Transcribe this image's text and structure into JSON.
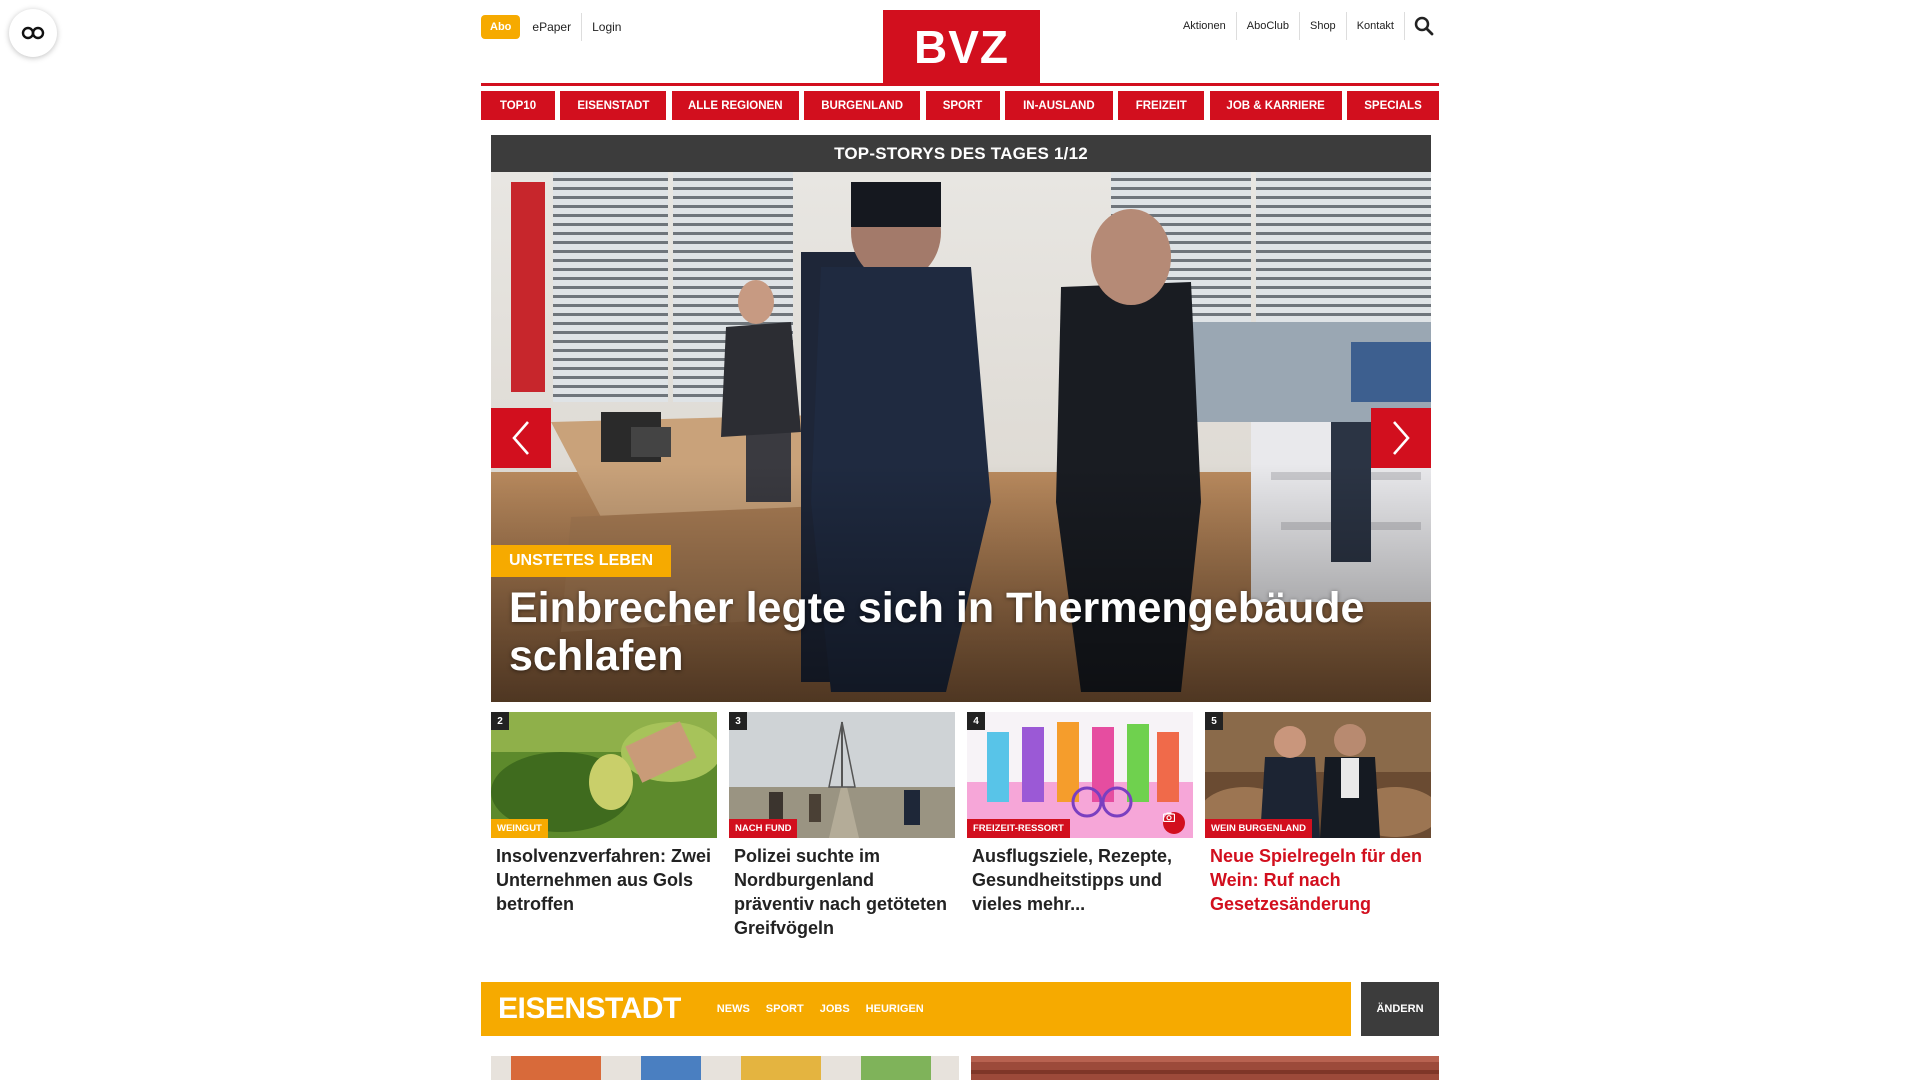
{
  "header": {
    "abo_label": "Abo",
    "epaper_label": "ePaper",
    "login_label": "Login",
    "logo_text": "BVZ",
    "right_links": [
      "Aktionen",
      "AboClub",
      "Shop",
      "Kontakt"
    ]
  },
  "nav": {
    "items": [
      "TOP10",
      "EISENSTADT",
      "ALLE REGIONEN",
      "BURGENLAND",
      "SPORT",
      "IN-AUSLAND",
      "FREIZEIT",
      "JOB & KARRIERE",
      "SPECIALS"
    ]
  },
  "slider": {
    "heading": "TOP-STORYS DES TAGES 1/12",
    "hero_tag": "UNSTETES LEBEN",
    "hero_title": "Einbrecher legte sich in Thermengebäude schlafen"
  },
  "cards": [
    {
      "num": "2",
      "tag": "WEINGUT",
      "title": "Insolvenzverfahren: Zwei Unternehmen aus Gols betroffen"
    },
    {
      "num": "3",
      "tag": "NACH FUND",
      "title": "Polizei suchte im Nordburgenland präventiv nach getöteten Greifvögeln"
    },
    {
      "num": "4",
      "tag": "FREIZEIT-RESSORT",
      "title": "Ausflugsziele, Rezepte, Gesundheitstipps und vieles mehr..."
    },
    {
      "num": "5",
      "tag": "WEIN BURGENLAND",
      "title": "Neue Spielregeln für den Wein: Ruf nach Gesetzesänderung"
    }
  ],
  "region": {
    "title": "EISENSTADT",
    "links": [
      "NEWS",
      "SPORT",
      "JOBS",
      "HEURIGEN"
    ],
    "change_label": "ÄNDERN"
  },
  "colors": {
    "brand_red": "#d20f1e",
    "accent_yellow": "#f6aa00",
    "dark_bar": "#3c3c3c"
  }
}
